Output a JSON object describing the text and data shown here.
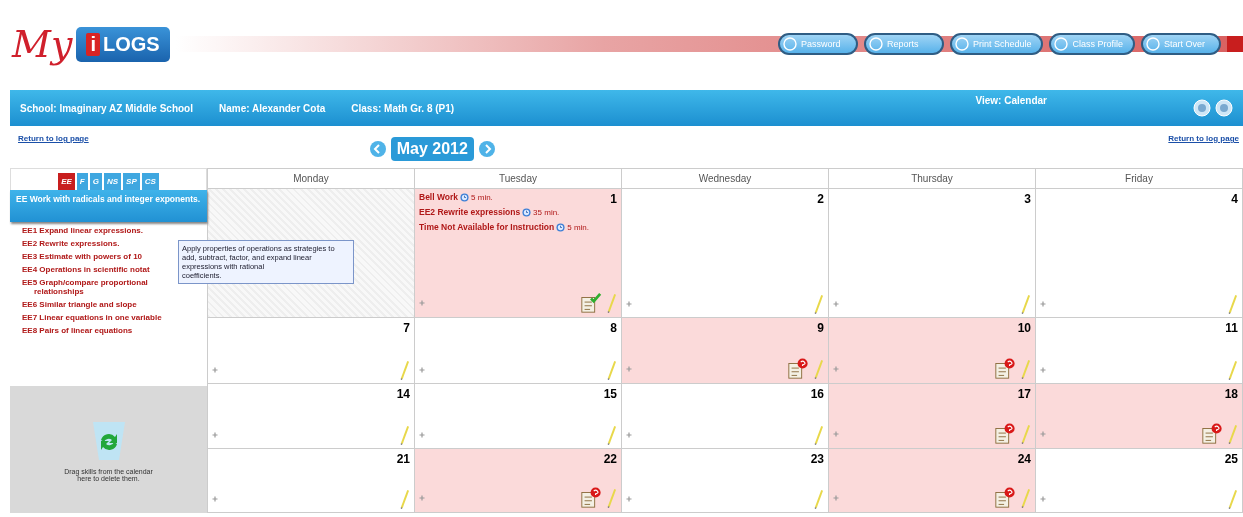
{
  "header": {
    "logo": {
      "script": "My",
      "badge_letter": "i",
      "badge_text": "LOGS"
    },
    "buttons": [
      {
        "label": "Password"
      },
      {
        "label": "Reports"
      },
      {
        "label": "Print Schedule"
      },
      {
        "label": "Class Profile"
      },
      {
        "label": "Start Over"
      }
    ]
  },
  "info_bar": {
    "school": "School: Imaginary AZ Middle School",
    "name": "Name: Alexander Cota",
    "class": "Class: Math Gr. 8 (P1)",
    "view": "View: Calendar"
  },
  "links": {
    "left": "Return to log page",
    "right": "Return to log page"
  },
  "month": "May 2012",
  "sidebar": {
    "tabs": [
      {
        "label": "EE",
        "selected": true
      },
      {
        "label": "F",
        "selected": false
      },
      {
        "label": "G",
        "selected": false
      },
      {
        "label": "NS",
        "selected": false
      },
      {
        "label": "SP",
        "selected": false
      },
      {
        "label": "CS",
        "selected": false
      }
    ],
    "heading": "EE Work with radicals and integer exponents.",
    "items": [
      "EE1 Expand linear expressions.",
      "EE2 Rewrite expressions.",
      "EE3 Estimate with powers of 10",
      "EE4 Operations in scientific notat",
      "EE5 Graph/compare proportional relationships",
      "EE6 Similar triangle and slope",
      "EE7 Linear equations in one variable",
      "EE8 Pairs of linear equations"
    ],
    "tooltip": "Apply properties of operations as strategies to add, subtract, factor, and expand linear expressions with rational\ncoefficients.",
    "trash_text": "Drag skills from the calendar here to delete them."
  },
  "calendar": {
    "weekdays": [
      "Monday",
      "Tuesday",
      "Wednesday",
      "Thursday",
      "Friday"
    ],
    "weeks": [
      [
        {
          "kind": "empty"
        },
        {
          "kind": "day",
          "day": "1",
          "highlighted": true,
          "approved": true,
          "flagged": false,
          "events": [
            {
              "title": "Bell Work",
              "time": "5 min."
            },
            {
              "title": "EE2 Rewrite expressions",
              "time": "35 min."
            },
            {
              "title": "Time Not Available for Instruction",
              "time": "5 min."
            }
          ]
        },
        {
          "kind": "day",
          "day": "2",
          "highlighted": false,
          "approved": false,
          "flagged": false
        },
        {
          "kind": "day",
          "day": "3",
          "highlighted": false,
          "approved": false,
          "flagged": false
        },
        {
          "kind": "day",
          "day": "4",
          "highlighted": false,
          "approved": false,
          "flagged": false
        }
      ],
      [
        {
          "kind": "day",
          "day": "7",
          "highlighted": false,
          "approved": false,
          "flagged": false
        },
        {
          "kind": "day",
          "day": "8",
          "highlighted": false,
          "approved": false,
          "flagged": false
        },
        {
          "kind": "day",
          "day": "9",
          "highlighted": true,
          "approved": false,
          "flagged": true
        },
        {
          "kind": "day",
          "day": "10",
          "highlighted": true,
          "approved": false,
          "flagged": true
        },
        {
          "kind": "day",
          "day": "11",
          "highlighted": false,
          "approved": false,
          "flagged": false
        }
      ],
      [
        {
          "kind": "day",
          "day": "14",
          "highlighted": false,
          "approved": false,
          "flagged": false
        },
        {
          "kind": "day",
          "day": "15",
          "highlighted": false,
          "approved": false,
          "flagged": false
        },
        {
          "kind": "day",
          "day": "16",
          "highlighted": false,
          "approved": false,
          "flagged": false
        },
        {
          "kind": "day",
          "day": "17",
          "highlighted": true,
          "approved": false,
          "flagged": true
        },
        {
          "kind": "day",
          "day": "18",
          "highlighted": true,
          "approved": false,
          "flagged": true
        }
      ],
      [
        {
          "kind": "day",
          "day": "21",
          "highlighted": false,
          "approved": false,
          "flagged": false
        },
        {
          "kind": "day",
          "day": "22",
          "highlighted": true,
          "approved": false,
          "flagged": true
        },
        {
          "kind": "day",
          "day": "23",
          "highlighted": false,
          "approved": false,
          "flagged": false
        },
        {
          "kind": "day",
          "day": "24",
          "highlighted": true,
          "approved": false,
          "flagged": true
        },
        {
          "kind": "day",
          "day": "25",
          "highlighted": false,
          "approved": false,
          "flagged": false
        }
      ]
    ]
  }
}
